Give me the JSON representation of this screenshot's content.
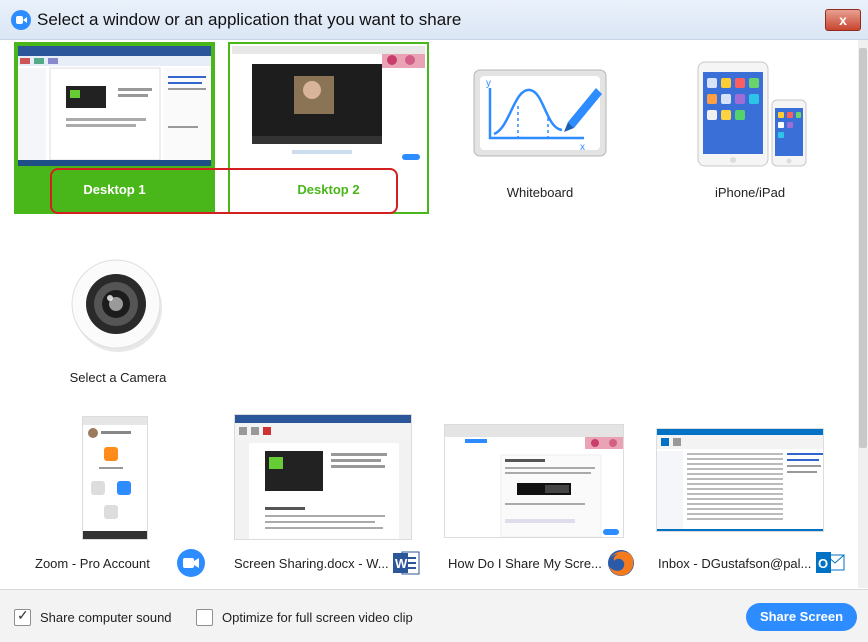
{
  "window": {
    "title": "Select a window or an application that you want to share",
    "close_label": "x"
  },
  "screens": [
    {
      "label": "Desktop 1",
      "selected": true
    },
    {
      "label": "Desktop 2",
      "selected": false
    }
  ],
  "options": {
    "whiteboard": "Whiteboard",
    "iphone": "iPhone/iPad",
    "camera": "Select a Camera"
  },
  "windows": [
    {
      "label": "Zoom - Pro Account",
      "icon": "zoom-icon"
    },
    {
      "label": "Screen Sharing.docx - W...",
      "icon": "word-icon"
    },
    {
      "label": "How Do I Share My Scre...",
      "icon": "firefox-icon"
    },
    {
      "label": "Inbox - DGustafson@pal...",
      "icon": "outlook-icon"
    }
  ],
  "footer": {
    "share_sound_label": "Share computer sound",
    "share_sound_checked": true,
    "optimize_label": "Optimize for full screen video clip",
    "optimize_checked": false,
    "share_button": "Share Screen"
  },
  "colors": {
    "accent_green": "#49b61a",
    "zoom_blue": "#2d8cff",
    "highlight_red": "#d31f1f"
  }
}
